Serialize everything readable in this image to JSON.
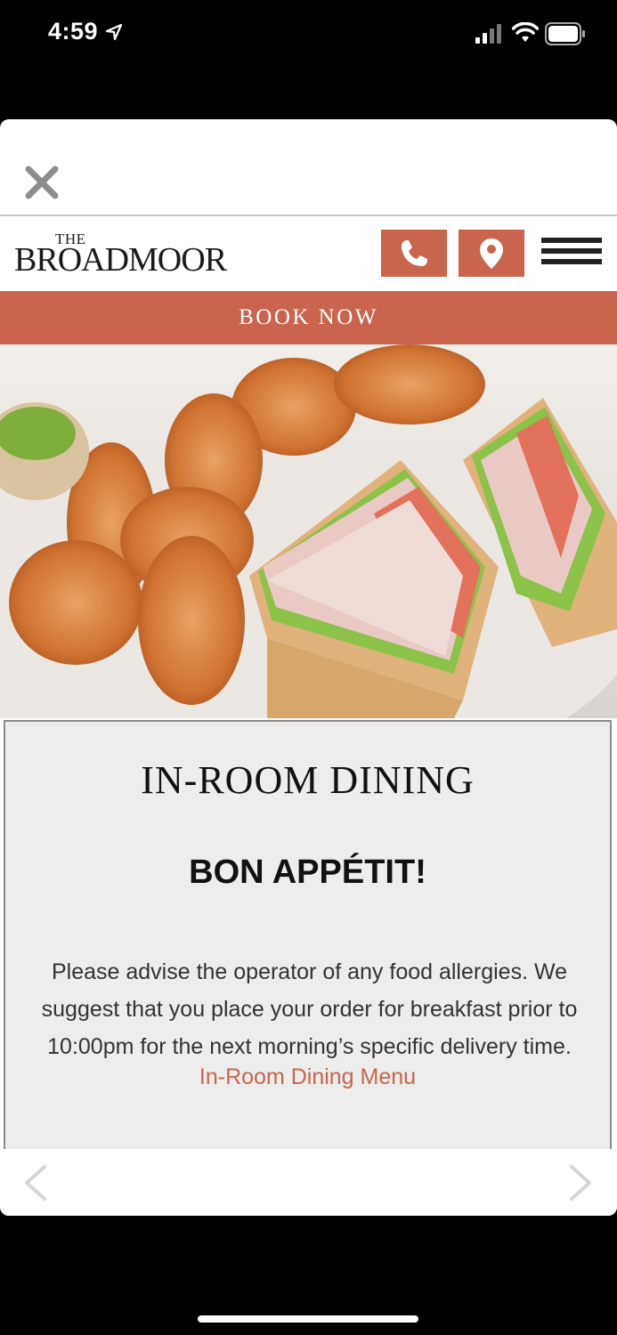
{
  "status_bar": {
    "time": "4:59"
  },
  "header": {
    "logo_small": "THE",
    "logo_main": "BROADMOOR"
  },
  "book_now": {
    "label": "BOOK NOW"
  },
  "icons": {
    "close": "close-icon",
    "phone": "phone-icon",
    "map": "map-pin-icon",
    "menu": "hamburger-icon",
    "prev": "chevron-left-icon",
    "next": "chevron-right-icon"
  },
  "colors": {
    "accent": "#c9654d"
  },
  "content": {
    "title": "IN-ROOM DINING",
    "subtitle": "BON APPÉTIT!",
    "body": "Please advise the operator of any food allergies. We suggest that you place your order for breakfast prior to 10:00pm for the next morning’s specific delivery time.",
    "link": "In-Room Dining Menu"
  }
}
